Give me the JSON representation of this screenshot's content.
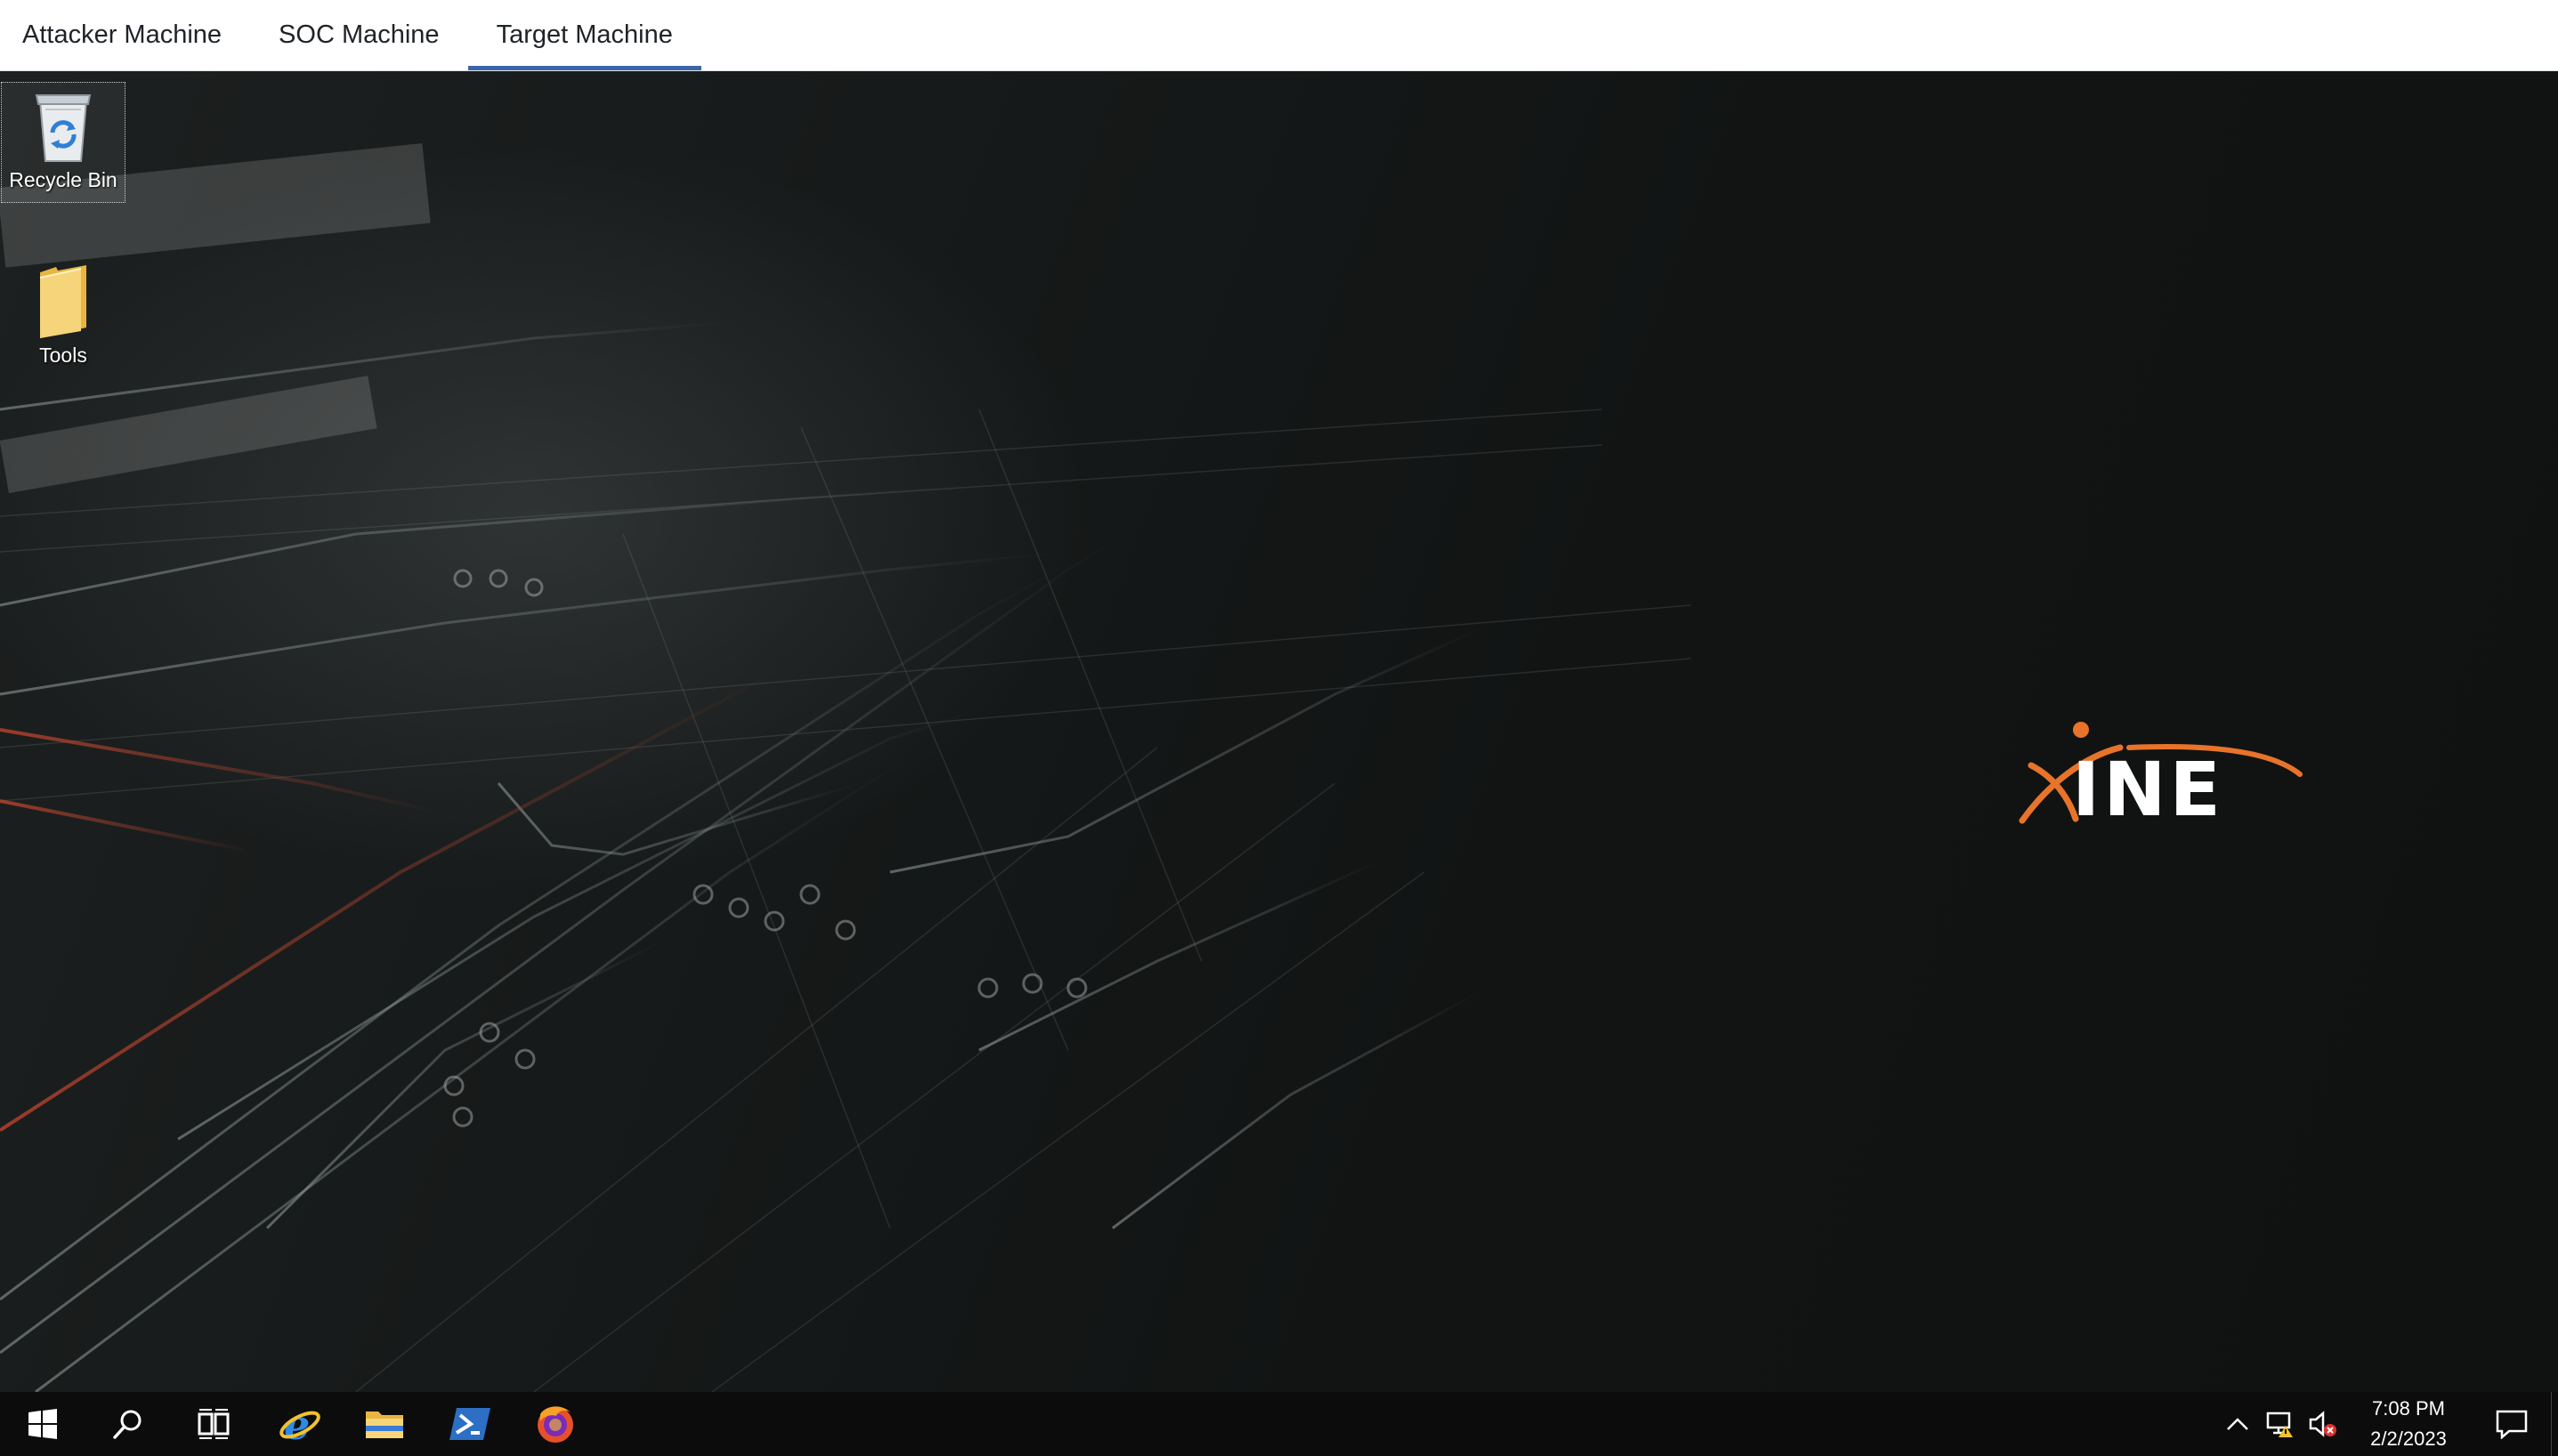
{
  "tabs": [
    {
      "label": "Attacker Machine",
      "active": false
    },
    {
      "label": "SOC Machine",
      "active": false
    },
    {
      "label": "Target Machine",
      "active": true
    }
  ],
  "desktop": {
    "icons": [
      {
        "label": "Recycle Bin",
        "icon": "recycle-bin-icon",
        "selected": true
      },
      {
        "label": "Tools",
        "icon": "folder-icon",
        "selected": false
      }
    ],
    "wallpaper_logo": "INE"
  },
  "taskbar": {
    "pinned": [
      {
        "name": "start-button",
        "icon": "windows-logo-icon"
      },
      {
        "name": "search-button",
        "icon": "search-icon"
      },
      {
        "name": "task-view-button",
        "icon": "task-view-icon"
      },
      {
        "name": "internet-explorer-button",
        "icon": "internet-explorer-icon"
      },
      {
        "name": "file-explorer-button",
        "icon": "folder-icon"
      },
      {
        "name": "powershell-button",
        "icon": "powershell-icon"
      },
      {
        "name": "firefox-button",
        "icon": "firefox-icon"
      }
    ],
    "tray": {
      "time": "7:08 PM",
      "date": "2/2/2023",
      "icons": [
        "chevron-up-icon",
        "network-warning-icon",
        "volume-muted-icon",
        "action-center-icon"
      ]
    }
  },
  "colors": {
    "tab_active_underline": "#3d66a8",
    "taskbar_bg": "#0c0c0c",
    "ine_orange": "#e8732a"
  }
}
